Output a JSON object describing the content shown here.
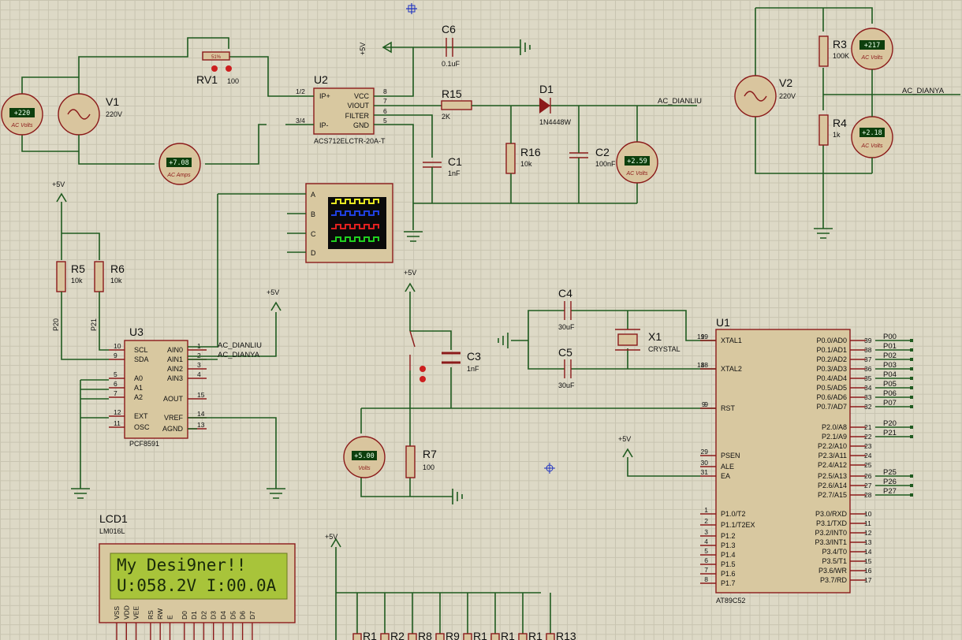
{
  "components": {
    "v1": {
      "ref": "V1",
      "value": "220V"
    },
    "v2": {
      "ref": "V2",
      "value": "220V"
    },
    "rv1": {
      "ref": "RV1",
      "value": "100",
      "wiper": "51%"
    },
    "u2": {
      "ref": "U2",
      "part": "ACS712ELCTR-20A-T",
      "pins_left": [
        "IP+",
        "IP-"
      ],
      "pins_right": [
        "VCC",
        "VIOUT",
        "FILTER",
        "GND"
      ],
      "pin_nums_left": [
        "1/2",
        "3/4"
      ],
      "pin_nums_right": [
        "8",
        "7",
        "6",
        "5"
      ]
    },
    "c6": {
      "ref": "C6",
      "value": "0.1uF"
    },
    "r15": {
      "ref": "R15",
      "value": "2K"
    },
    "d1": {
      "ref": "D1",
      "value": "1N4448W"
    },
    "c1": {
      "ref": "C1",
      "value": "1nF"
    },
    "r16": {
      "ref": "R16",
      "value": "10k"
    },
    "c2": {
      "ref": "C2",
      "value": "100nF"
    },
    "r3": {
      "ref": "R3",
      "value": "100K"
    },
    "r4": {
      "ref": "R4",
      "value": "1k"
    },
    "r5": {
      "ref": "R5",
      "value": "10k"
    },
    "r6": {
      "ref": "R6",
      "value": "10k"
    },
    "r7": {
      "ref": "R7",
      "value": "100"
    },
    "c3": {
      "ref": "C3",
      "value": "1nF"
    },
    "c4": {
      "ref": "C4",
      "value": "30uF"
    },
    "c5": {
      "ref": "C5",
      "value": "30uF"
    },
    "x1": {
      "ref": "X1",
      "value": "CRYSTAL"
    },
    "u3": {
      "ref": "U3",
      "part": "PCF8591"
    },
    "u1": {
      "ref": "U1",
      "part": "AT89C52"
    },
    "lcd": {
      "ref": "LCD1",
      "part": "LM016L",
      "line1": "My Desi9ner!!",
      "line2": "U:058.2V I:00.0A"
    }
  },
  "meters": {
    "v1_volts": {
      "value": "+220",
      "unit": "AC Volts"
    },
    "amps": {
      "value": "+7.08",
      "unit": "AC Amps"
    },
    "c2_volts": {
      "value": "+2.59",
      "unit": "AC Volts"
    },
    "r3_volts": {
      "value": "+217",
      "unit": "AC Volts"
    },
    "r4_volts": {
      "value": "+2.18",
      "unit": "AC Volts"
    },
    "rst_volts": {
      "value": "+5.00",
      "unit": "Volts"
    }
  },
  "power": {
    "vcc": "+5V"
  },
  "nets": {
    "dianliu": "AC_DIANLIU",
    "dianya": "AC_DIANYA",
    "p20": "P20",
    "p21": "P21"
  },
  "scope_channels": [
    "A",
    "B",
    "C",
    "D"
  ],
  "u3_pins": {
    "left": [
      {
        "num": "10",
        "name": "SCL"
      },
      {
        "num": "9",
        "name": "SDA"
      },
      {
        "num": "5",
        "name": "A0"
      },
      {
        "num": "6",
        "name": "A1"
      },
      {
        "num": "7",
        "name": "A2"
      },
      {
        "num": "12",
        "name": "EXT"
      },
      {
        "num": "11",
        "name": "OSC"
      }
    ],
    "right": [
      {
        "num": "1",
        "name": "AIN0"
      },
      {
        "num": "2",
        "name": "AIN1"
      },
      {
        "num": "3",
        "name": "AIN2"
      },
      {
        "num": "4",
        "name": "AIN3"
      },
      {
        "num": "15",
        "name": "AOUT"
      },
      {
        "num": "14",
        "name": "VREF"
      },
      {
        "num": "13",
        "name": "AGND"
      }
    ]
  },
  "u1_pins": {
    "left": [
      {
        "num": "19",
        "name": "XTAL1"
      },
      {
        "num": "18",
        "name": "XTAL2"
      },
      {
        "num": "9",
        "name": "RST"
      },
      {
        "num": "29",
        "name": "PSEN"
      },
      {
        "num": "30",
        "name": "ALE"
      },
      {
        "num": "31",
        "name": "EA"
      },
      {
        "num": "1",
        "name": "P1.0/T2"
      },
      {
        "num": "2",
        "name": "P1.1/T2EX"
      },
      {
        "num": "3",
        "name": "P1.2"
      },
      {
        "num": "4",
        "name": "P1.3"
      },
      {
        "num": "5",
        "name": "P1.4"
      },
      {
        "num": "6",
        "name": "P1.5"
      },
      {
        "num": "7",
        "name": "P1.6"
      },
      {
        "num": "8",
        "name": "P1.7"
      }
    ],
    "right": [
      {
        "num": "39",
        "name": "P0.0/AD0",
        "net": "P00"
      },
      {
        "num": "38",
        "name": "P0.1/AD1",
        "net": "P01"
      },
      {
        "num": "37",
        "name": "P0.2/AD2",
        "net": "P02"
      },
      {
        "num": "36",
        "name": "P0.3/AD3",
        "net": "P03"
      },
      {
        "num": "35",
        "name": "P0.4/AD4",
        "net": "P04"
      },
      {
        "num": "34",
        "name": "P0.5/AD5",
        "net": "P05"
      },
      {
        "num": "33",
        "name": "P0.6/AD6",
        "net": "P06"
      },
      {
        "num": "32",
        "name": "P0.7/AD7",
        "net": "P07"
      },
      {
        "num": "21",
        "name": "P2.0/A8",
        "net": "P20"
      },
      {
        "num": "22",
        "name": "P2.1/A9",
        "net": "P21"
      },
      {
        "num": "23",
        "name": "P2.2/A10",
        "net": ""
      },
      {
        "num": "24",
        "name": "P2.3/A11",
        "net": ""
      },
      {
        "num": "25",
        "name": "P2.4/A12",
        "net": ""
      },
      {
        "num": "26",
        "name": "P2.5/A13",
        "net": "P25"
      },
      {
        "num": "27",
        "name": "P2.6/A14",
        "net": "P26"
      },
      {
        "num": "28",
        "name": "P2.7/A15",
        "net": "P27"
      },
      {
        "num": "10",
        "name": "P3.0/RXD",
        "net": ""
      },
      {
        "num": "11",
        "name": "P3.1/TXD",
        "net": ""
      },
      {
        "num": "12",
        "name": "P3.2/INT0",
        "net": ""
      },
      {
        "num": "13",
        "name": "P3.3/INT1",
        "net": ""
      },
      {
        "num": "14",
        "name": "P3.4/T0",
        "net": ""
      },
      {
        "num": "15",
        "name": "P3.5/T1",
        "net": ""
      },
      {
        "num": "16",
        "name": "P3.6/WR",
        "net": ""
      },
      {
        "num": "17",
        "name": "P3.7/RD",
        "net": ""
      }
    ]
  },
  "lcd_pins": [
    "VSS",
    "VDD",
    "VEE",
    "RS",
    "RW",
    "E",
    "D0",
    "D1",
    "D2",
    "D3",
    "D4",
    "D5",
    "D6",
    "D7"
  ],
  "bottom_resistors": [
    "R1",
    "R2",
    "R8",
    "R9",
    "R1",
    "R1",
    "R1",
    "R13"
  ],
  "colors": {
    "wire": "#1f5a1f",
    "body": "#8b1a1a",
    "chip_fill": "#d8c8a0",
    "background": "#ddd9c6",
    "lcd": "#a8c43a"
  }
}
